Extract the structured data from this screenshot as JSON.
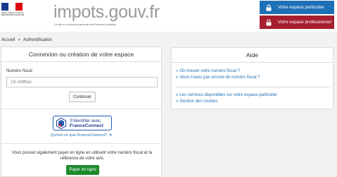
{
  "header": {
    "logo_text": "impots.gouv.fr",
    "logo_subtitle": "Un site de la direction générale des Finances publiques",
    "marianne_text": "Liberté • Égalité • Fraternité RÉPUBLIQUE FRANÇAISE",
    "btn_particulier": "Votre espace particulier",
    "btn_professionnel": "Votre espace professionnel",
    "colors": {
      "particulier": "#1e70b6",
      "professionnel": "#a71f2f"
    }
  },
  "breadcrumb": {
    "home": "Accueil",
    "separator": ">",
    "current": "Authentification"
  },
  "login": {
    "title": "Connexion ou création de votre espace",
    "field_label": "Numéro fiscal",
    "field_placeholder": "13 chiffres",
    "continue_label": "Continuer",
    "franceconnect_line1": "S'identifier avec",
    "franceconnect_line2": "FranceConnect",
    "franceconnect_link": "Qu'est-ce que FranceConnect?",
    "pay_text": "Vous pouvez également payer en ligne en utilisant votre numéro fiscal et la référence de votre avis",
    "pay_button": "Payer en ligne"
  },
  "aide": {
    "title": "Aide",
    "links_a": [
      "Où trouver votre numéro fiscal ?",
      "Vous n'avez pas encore de numéro fiscal ?"
    ],
    "links_b": [
      "Les services disponibles sur votre espace particulier",
      "Gestion des cookies"
    ]
  }
}
